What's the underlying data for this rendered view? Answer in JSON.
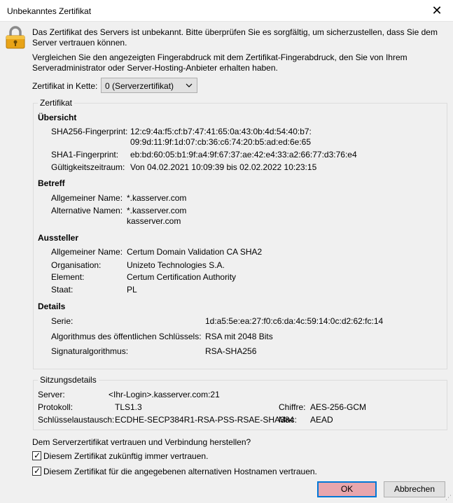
{
  "window": {
    "title": "Unbekanntes Zertifikat",
    "close": "✕"
  },
  "message": {
    "line1": "Das Zertifikat des Servers ist unbekannt. Bitte überprüfen Sie es sorgfältig, um sicherzustellen, dass Sie dem Server vertrauen können.",
    "line2": "Vergleichen Sie den angezeigten Fingerabdruck mit dem Zertifikat-Fingerabdruck, den Sie von Ihrem Serveradministrator oder Server-Hosting-Anbieter erhalten haben."
  },
  "chain": {
    "label": "Zertifikat in Kette:",
    "selected": "0 (Serverzertifikat)"
  },
  "certificate": {
    "legend": "Zertifikat",
    "overview": {
      "heading": "Übersicht",
      "sha256_label": "SHA256-Fingerprint:",
      "sha256_line1": "12:c9:4a:f5:cf:b7:47:41:65:0a:43:0b:4d:54:40:b7:",
      "sha256_line2": "09:9d:11:9f:1d:07:cb:36:c6:74:20:b5:ad:ed:6e:65",
      "sha1_label": "SHA1-Fingerprint:",
      "sha1_value": "eb:bd:60:05:b1:9f:a4:9f:67:37:ae:42:e4:33:a2:66:77:d3:76:e4",
      "validity_label": "Gültigkeitszeitraum:",
      "validity_value": "Von 04.02.2021 10:09:39 bis 02.02.2022 10:23:15"
    },
    "subject": {
      "heading": "Betreff",
      "cn_label": "Allgemeiner Name:",
      "cn_value": "*.kasserver.com",
      "alt_label": "Alternative Namen:",
      "alt_line1": "*.kasserver.com",
      "alt_line2": "kasserver.com"
    },
    "issuer": {
      "heading": "Aussteller",
      "cn_label": "Allgemeiner Name:",
      "cn_value": "Certum Domain Validation CA SHA2",
      "org_label": "Organisation:",
      "org_value": "Unizeto Technologies S.A.",
      "element_label": "Element:",
      "element_value": "Certum Certification Authority",
      "state_label": "Staat:",
      "state_value": "PL"
    },
    "details": {
      "heading": "Details",
      "serial_label": "Serie:",
      "serial_value": "1d:a5:5e:ea:27:f0:c6:da:4c:59:14:0c:d2:62:fc:14",
      "pubkey_label": "Algorithmus des öffentlichen Schlüssels:",
      "pubkey_value": "RSA mit 2048 Bits",
      "sig_label": "Signaturalgorithmus:",
      "sig_value": "RSA-SHA256"
    }
  },
  "session": {
    "legend": "Sitzungsdetails",
    "server_label": "Server:",
    "server_value": "<Ihr-Login>.kasserver.com:21",
    "protocol_label": "Protokoll:",
    "protocol_value": "TLS1.3",
    "cipher_label": "Chiffre:",
    "cipher_value": "AES-256-GCM",
    "kex_label": "Schlüsselaustausch:",
    "kex_value": "ECDHE-SECP384R1-RSA-PSS-RSAE-SHA384",
    "mac_label": "Mac:",
    "mac_value": "AEAD"
  },
  "trust": {
    "question": "Dem Serverzertifikat vertrauen und Verbindung herstellen?",
    "always_label": "Diesem Zertifikat zukünftig immer vertrauen.",
    "always_checked": true,
    "alt_hosts_label": "Diesem Zertifikat für die angegebenen alternativen Hostnamen vertrauen.",
    "alt_hosts_checked": true
  },
  "buttons": {
    "ok": "OK",
    "cancel": "Abbrechen"
  },
  "icons": {
    "lock": "lock-icon",
    "close": "close-icon",
    "chevron": "chevron-down-icon"
  },
  "colors": {
    "ok_fill": "#e8a6ad",
    "focus_border": "#0078d7",
    "lock_gold": "#e8a317"
  }
}
